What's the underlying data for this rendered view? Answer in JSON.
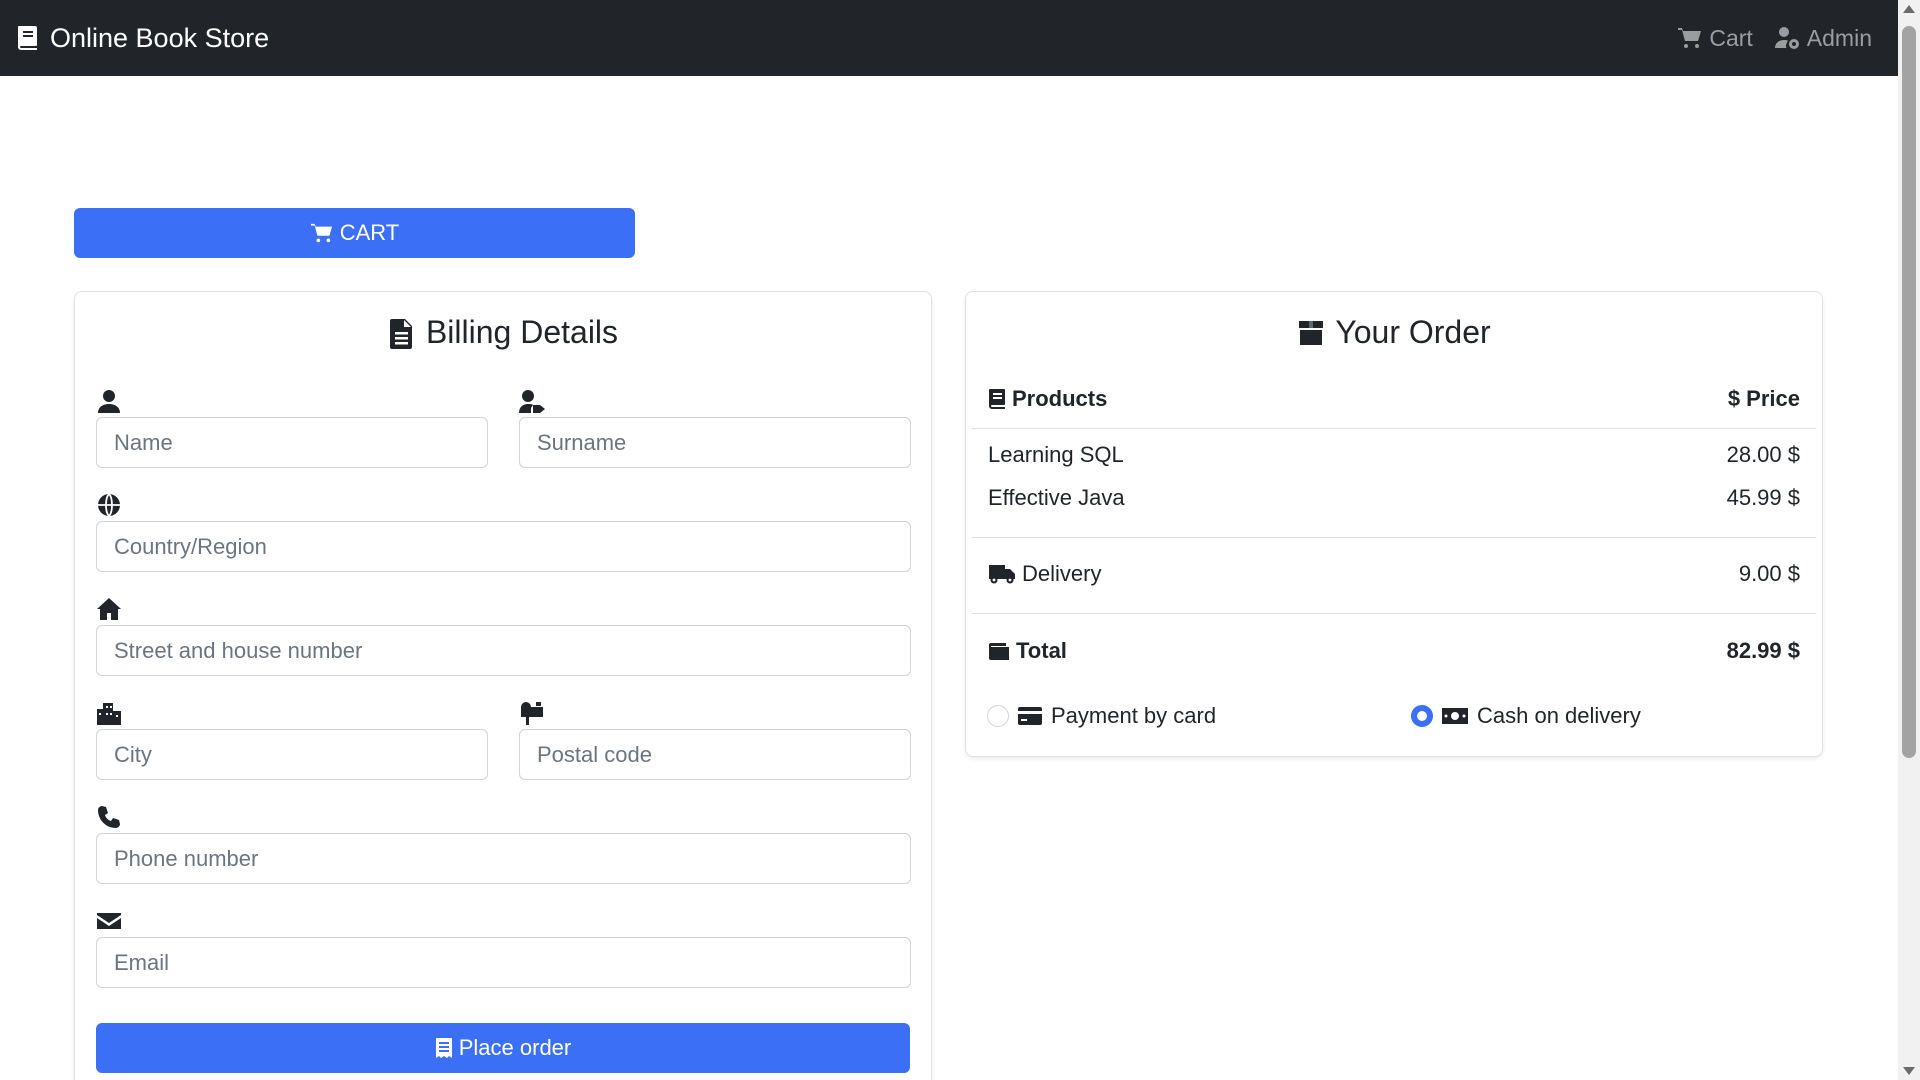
{
  "navbar": {
    "brand": "Online Book Store",
    "brand_icon": "book-icon",
    "links": [
      {
        "label": "Cart",
        "icon": "cart-icon"
      },
      {
        "label": "Admin",
        "icon": "user-gear-icon"
      }
    ]
  },
  "cart_button": {
    "label": "CART",
    "icon": "cart-icon"
  },
  "billing": {
    "title": "Billing Details",
    "title_icon": "file-lines-icon",
    "fields": {
      "name": {
        "placeholder": "Name",
        "value": "",
        "icon": "user-icon"
      },
      "surname": {
        "placeholder": "Surname",
        "value": "",
        "icon": "user-tag-icon"
      },
      "country": {
        "placeholder": "Country/Region",
        "value": "",
        "icon": "globe-icon"
      },
      "street": {
        "placeholder": "Street and house number",
        "value": "",
        "icon": "house-icon"
      },
      "city": {
        "placeholder": "City",
        "value": "",
        "icon": "city-icon"
      },
      "postal": {
        "placeholder": "Postal code",
        "value": "",
        "icon": "mailbox-icon"
      },
      "phone": {
        "placeholder": "Phone number",
        "value": "",
        "icon": "phone-icon"
      },
      "email": {
        "placeholder": "Email",
        "value": "",
        "icon": "envelope-icon"
      }
    },
    "submit_label": "Place order",
    "submit_icon": "receipt-icon"
  },
  "order": {
    "title": "Your Order",
    "title_icon": "box-icon",
    "header": {
      "products": "Products",
      "price": "$ Price"
    },
    "items": [
      {
        "name": "Learning SQL",
        "price": "28.00 $"
      },
      {
        "name": "Effective Java",
        "price": "45.99 $"
      }
    ],
    "delivery": {
      "label": "Delivery",
      "price": "9.00 $",
      "icon": "truck-icon"
    },
    "total": {
      "label": "Total",
      "price": "82.99 $",
      "icon": "wallet-icon"
    },
    "payment_options": [
      {
        "label": "Payment by card",
        "icon": "credit-card-icon",
        "checked": false
      },
      {
        "label": "Cash on delivery",
        "icon": "money-bill-icon",
        "checked": true
      }
    ]
  },
  "colors": {
    "navbar_bg": "#212529",
    "primary": "#3b6ff5",
    "border": "#dee2e6"
  }
}
